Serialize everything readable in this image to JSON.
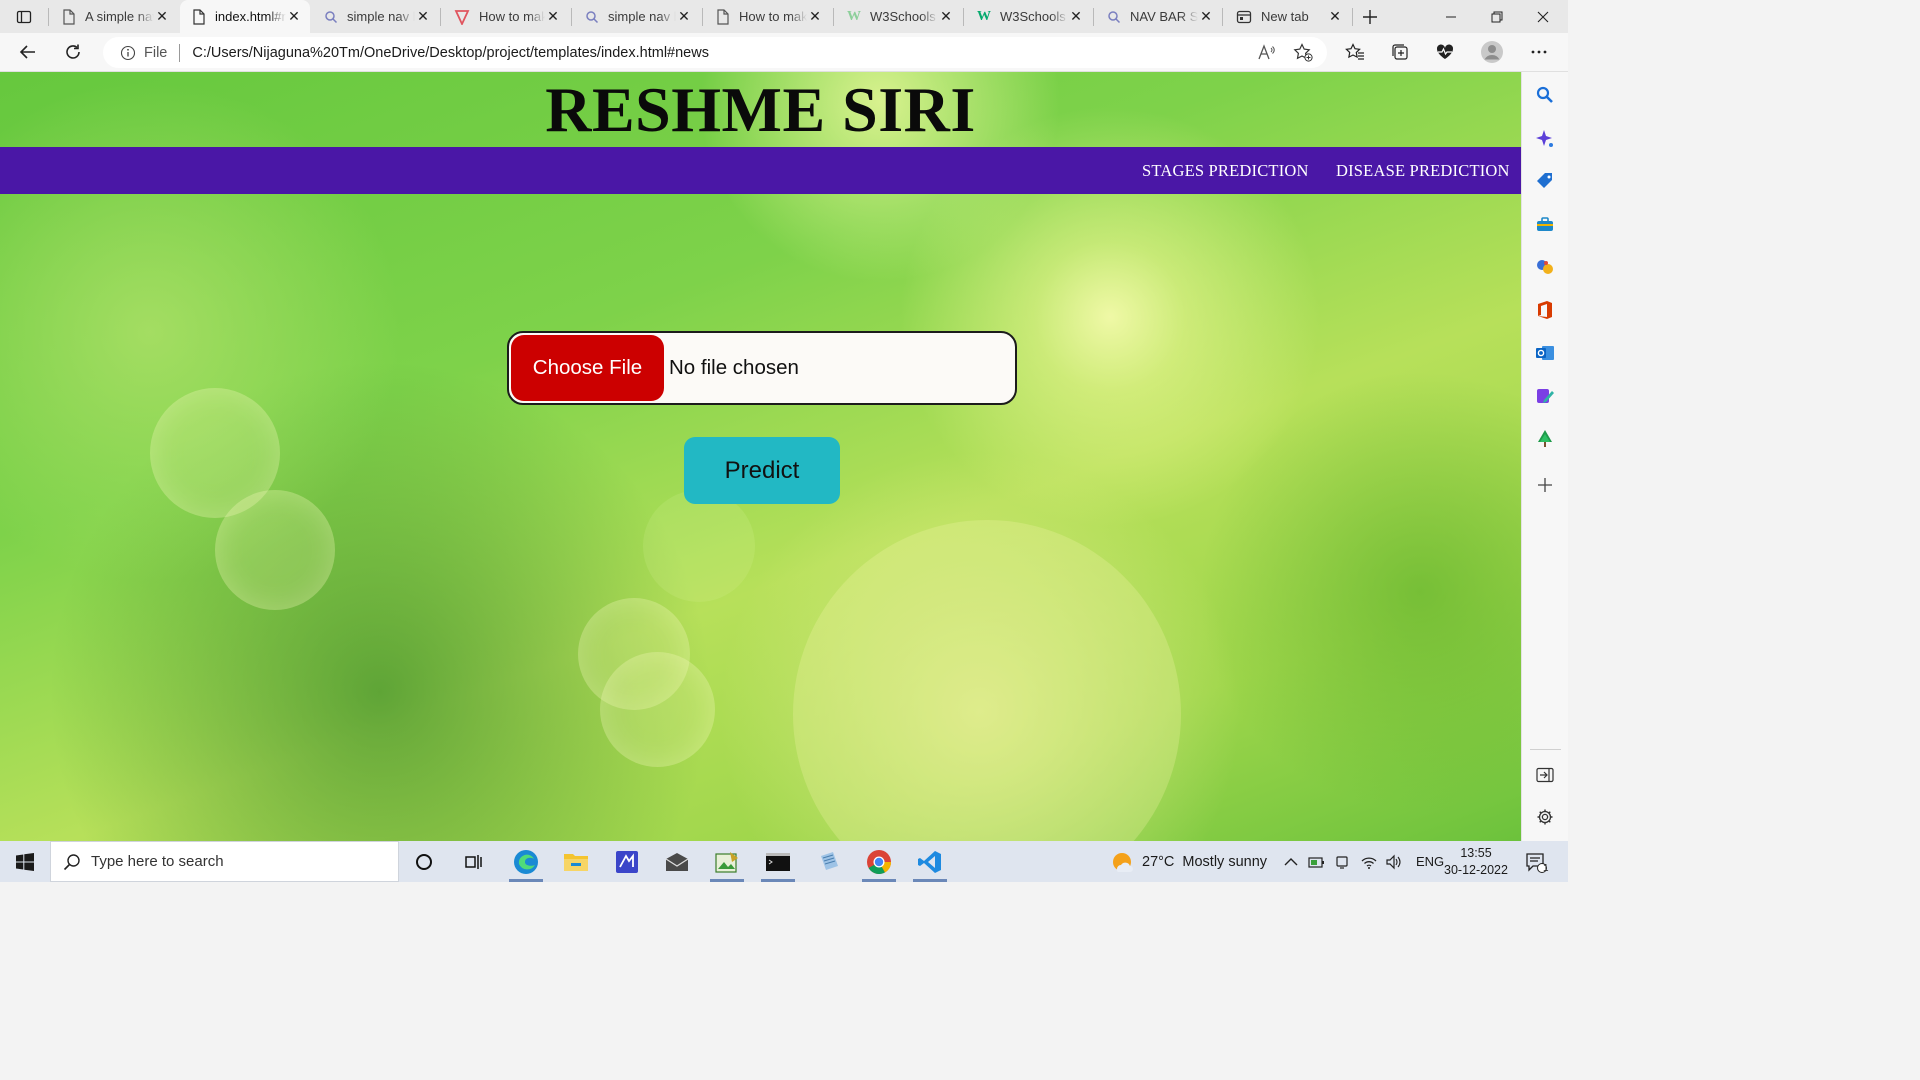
{
  "browser": {
    "tabs": [
      {
        "title": "A simple navigation bar",
        "icon": "page-icon",
        "active": false
      },
      {
        "title": "index.html#news",
        "icon": "page-icon",
        "active": true
      },
      {
        "title": "simple nav bar",
        "icon": "search-icon",
        "active": false
      },
      {
        "title": "How to make a navbar",
        "icon": "vivaldi-icon",
        "active": false
      },
      {
        "title": "simple nav bar",
        "icon": "search-icon",
        "active": false
      },
      {
        "title": "How to make a navbar",
        "icon": "page-icon",
        "active": false
      },
      {
        "title": "W3Schools",
        "icon": "w3schools-icon",
        "active": false
      },
      {
        "title": "W3Schools",
        "icon": "w3schools-icon",
        "active": false
      },
      {
        "title": "NAV BAR SI",
        "icon": "search-icon",
        "active": false
      },
      {
        "title": "New tab",
        "icon": "newtab-icon",
        "active": false
      }
    ],
    "address": {
      "scheme_label": "File",
      "url": "C:/Users/Nijaguna%20Tm/OneDrive/Desktop/project/templates/index.html#news"
    }
  },
  "page": {
    "title": "RESHME SIRI",
    "nav": [
      {
        "label": "STAGES PREDICTION"
      },
      {
        "label": "DISEASE PREDICTION"
      }
    ],
    "upload": {
      "button_label": "Choose File",
      "status": "No file chosen"
    },
    "predict_label": "Predict",
    "colors": {
      "navbar": "#4a17a6",
      "choose_button": "#cc0000",
      "predict_button": "#22b8c4"
    }
  },
  "taskbar": {
    "search_placeholder": "Type here to search",
    "weather": {
      "temp": "27°C",
      "condition": "Mostly sunny"
    },
    "language": "ENG",
    "time": "13:55",
    "date": "30-12-2022",
    "notification_count": "1"
  }
}
